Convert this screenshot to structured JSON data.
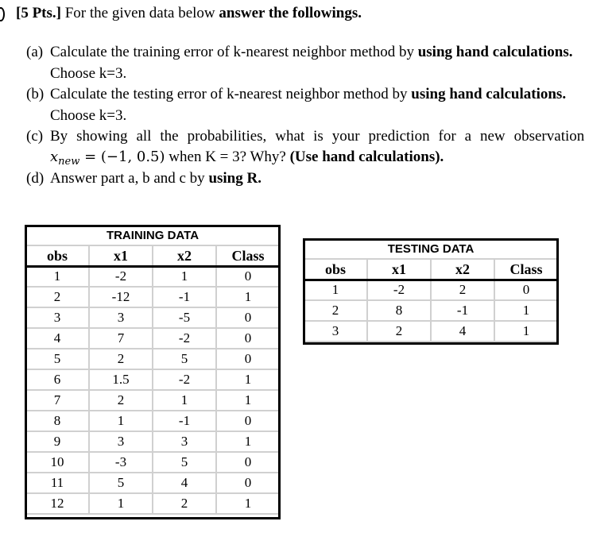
{
  "header": {
    "points": "[5 Pts.]",
    "intro": " For the given data below ",
    "intro_bold": "answer the followings."
  },
  "questions": [
    {
      "label": "(a)",
      "text": "Calculate the training error of k-nearest neighbor method by ",
      "bold": "using hand calculations.",
      "cont": "Choose k=3."
    },
    {
      "label": "(b)",
      "text": "Calculate the testing error of k-nearest neighbor method by ",
      "bold": "using hand calculations.",
      "cont": "Choose k=3."
    },
    {
      "label": "(c)",
      "text": "By showing all the probabilities, what is your prediction for a new observation",
      "math_var": "x",
      "math_sub": "new",
      "math_val": " = (−1, 0.5)",
      "cont_text": "  when K = 3? Why? ",
      "cont_bold": "(Use hand calculations)."
    },
    {
      "label": "(d)",
      "text": "Answer part a, b and c by ",
      "bold": "using R."
    }
  ],
  "training": {
    "title": "TRAINING DATA",
    "columns": [
      "obs",
      "x1",
      "x2",
      "Class"
    ],
    "rows": [
      [
        "1",
        "-2",
        "1",
        "0"
      ],
      [
        "2",
        "-12",
        "-1",
        "1"
      ],
      [
        "3",
        "3",
        "-5",
        "0"
      ],
      [
        "4",
        "7",
        "-2",
        "0"
      ],
      [
        "5",
        "2",
        "5",
        "0"
      ],
      [
        "6",
        "1.5",
        "-2",
        "1"
      ],
      [
        "7",
        "2",
        "1",
        "1"
      ],
      [
        "8",
        "1",
        "-1",
        "0"
      ],
      [
        "9",
        "3",
        "3",
        "1"
      ],
      [
        "10",
        "-3",
        "5",
        "0"
      ],
      [
        "11",
        "5",
        "4",
        "0"
      ],
      [
        "12",
        "1",
        "2",
        "1"
      ]
    ]
  },
  "testing": {
    "title": "TESTING DATA",
    "columns": [
      "obs",
      "x1",
      "x2",
      "Class"
    ],
    "rows": [
      [
        "1",
        "-2",
        "2",
        "0"
      ],
      [
        "2",
        "8",
        "-1",
        "1"
      ],
      [
        "3",
        "2",
        "4",
        "1"
      ]
    ]
  }
}
